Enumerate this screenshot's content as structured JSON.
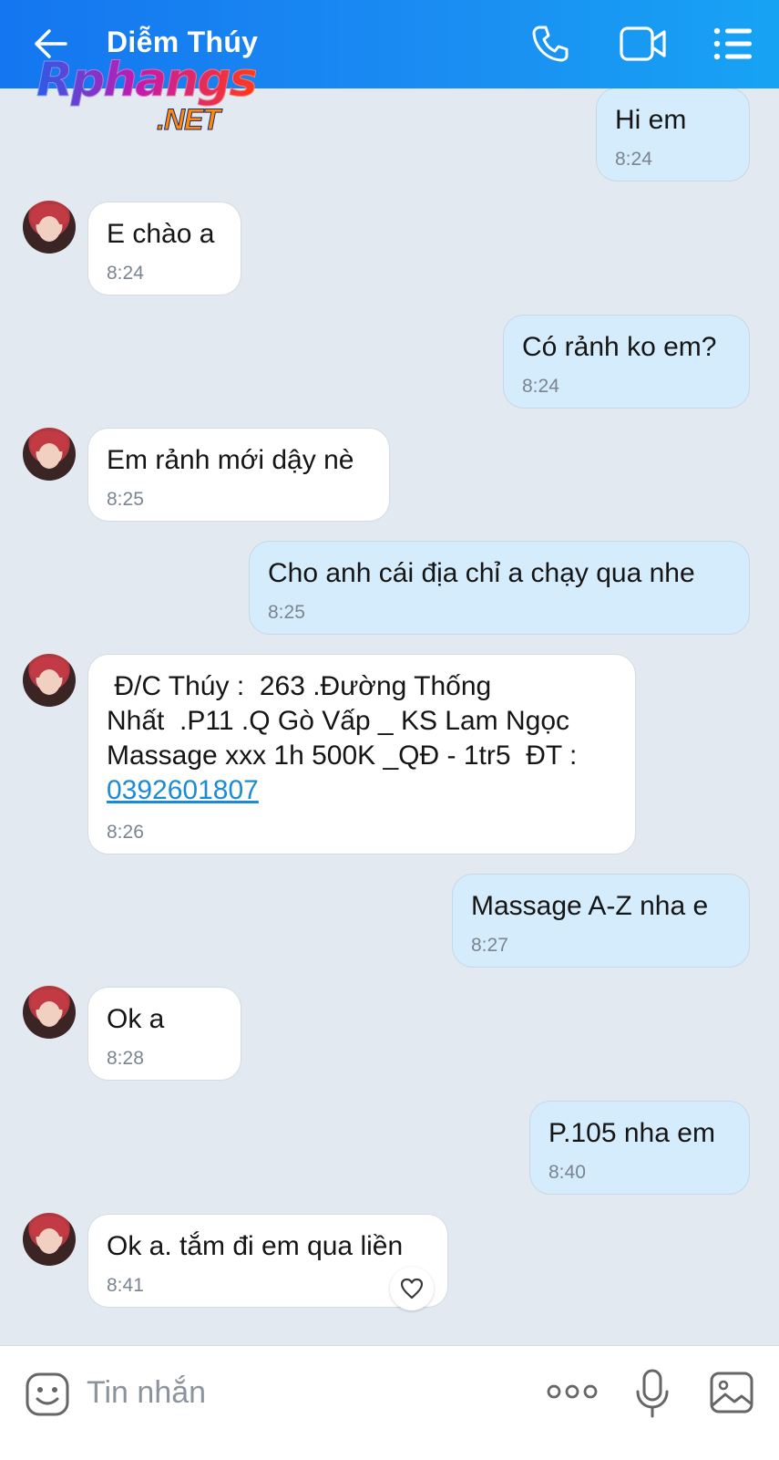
{
  "header": {
    "contact_name": "Diễm Thúy",
    "icons": [
      "back-arrow-icon",
      "phone-icon",
      "video-call-icon",
      "menu-list-icon"
    ]
  },
  "watermark": {
    "main": "Rphangs",
    "sub": ".NET"
  },
  "messages": [
    {
      "dir": "out",
      "text": "Hi em",
      "time": "8:24"
    },
    {
      "dir": "in",
      "text": "E chào a",
      "time": "8:24"
    },
    {
      "dir": "out",
      "text": "Có rảnh ko em?",
      "time": "8:24"
    },
    {
      "dir": "in",
      "text": "Em rảnh mới dậy nè",
      "time": "8:25"
    },
    {
      "dir": "out",
      "text": "Cho anh cái địa chỉ a chạy qua nhe",
      "time": "8:25"
    },
    {
      "dir": "in",
      "text": " Đ/C Thúy :  263 .Đường Thống\nNhất  .P11 .Q Gò Vấp _ KS Lam Ngọc\nMassage xxx 1h 500K _QĐ - 1tr5  ĐT :",
      "link": "0392601807",
      "time": "8:26"
    },
    {
      "dir": "out",
      "text": "Massage A-Z nha e",
      "time": "8:27"
    },
    {
      "dir": "in",
      "text": "Ok a",
      "time": "8:28"
    },
    {
      "dir": "out",
      "text": "P.105 nha em",
      "time": "8:40"
    },
    {
      "dir": "in",
      "text": "Ok a. tắm đi em qua liền",
      "time": "8:41"
    }
  ],
  "footer": {
    "input_placeholder": "Tin nhắn",
    "icons": [
      "emoji-icon",
      "more-options-icon",
      "microphone-icon",
      "image-icon"
    ]
  }
}
